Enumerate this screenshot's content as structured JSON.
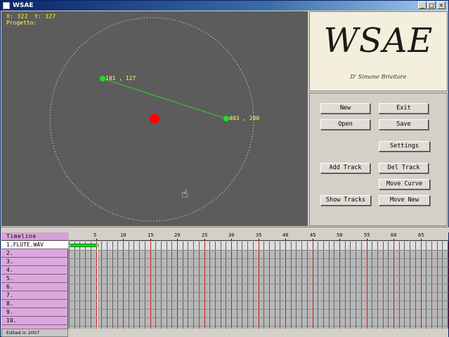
{
  "window": {
    "title": "WSAE",
    "minimize": "_",
    "maximize": "□",
    "close": "×"
  },
  "canvas": {
    "coord_x": "X: 322",
    "coord_y": "Y: 327",
    "project_label": "Progetto:",
    "point_a_label": "101 , 127",
    "point_b_label": "403 , 200",
    "colors": {
      "background": "#5c5c5c",
      "line": "#22dd22",
      "point": "#22dd22",
      "source": "#ff0000",
      "ring": "#cccccc"
    }
  },
  "logo": {
    "title": "WSAE",
    "subtitle": "D' Simone Brivitore"
  },
  "controls": {
    "new": "New",
    "exit": "Exit",
    "open": "Open",
    "save": "Save",
    "settings": "Settings",
    "add_track": "Add Track",
    "del_track": "Del Track",
    "move_curve": "Move Curve",
    "show_tracks": "Show Tracks",
    "move_new": "Move New"
  },
  "timeline": {
    "header": "Timeline",
    "tracks": [
      "1.FLUTE.WAV",
      "2.",
      "3.",
      "4.",
      "5.",
      "6.",
      "7.",
      "8.",
      "9.",
      "10."
    ],
    "ruler": [
      "5",
      "10",
      "15",
      "20",
      "25",
      "30",
      "35",
      "40",
      "45",
      "50",
      "55",
      "60",
      "65"
    ]
  },
  "status": {
    "text": "Edited in 2007"
  }
}
